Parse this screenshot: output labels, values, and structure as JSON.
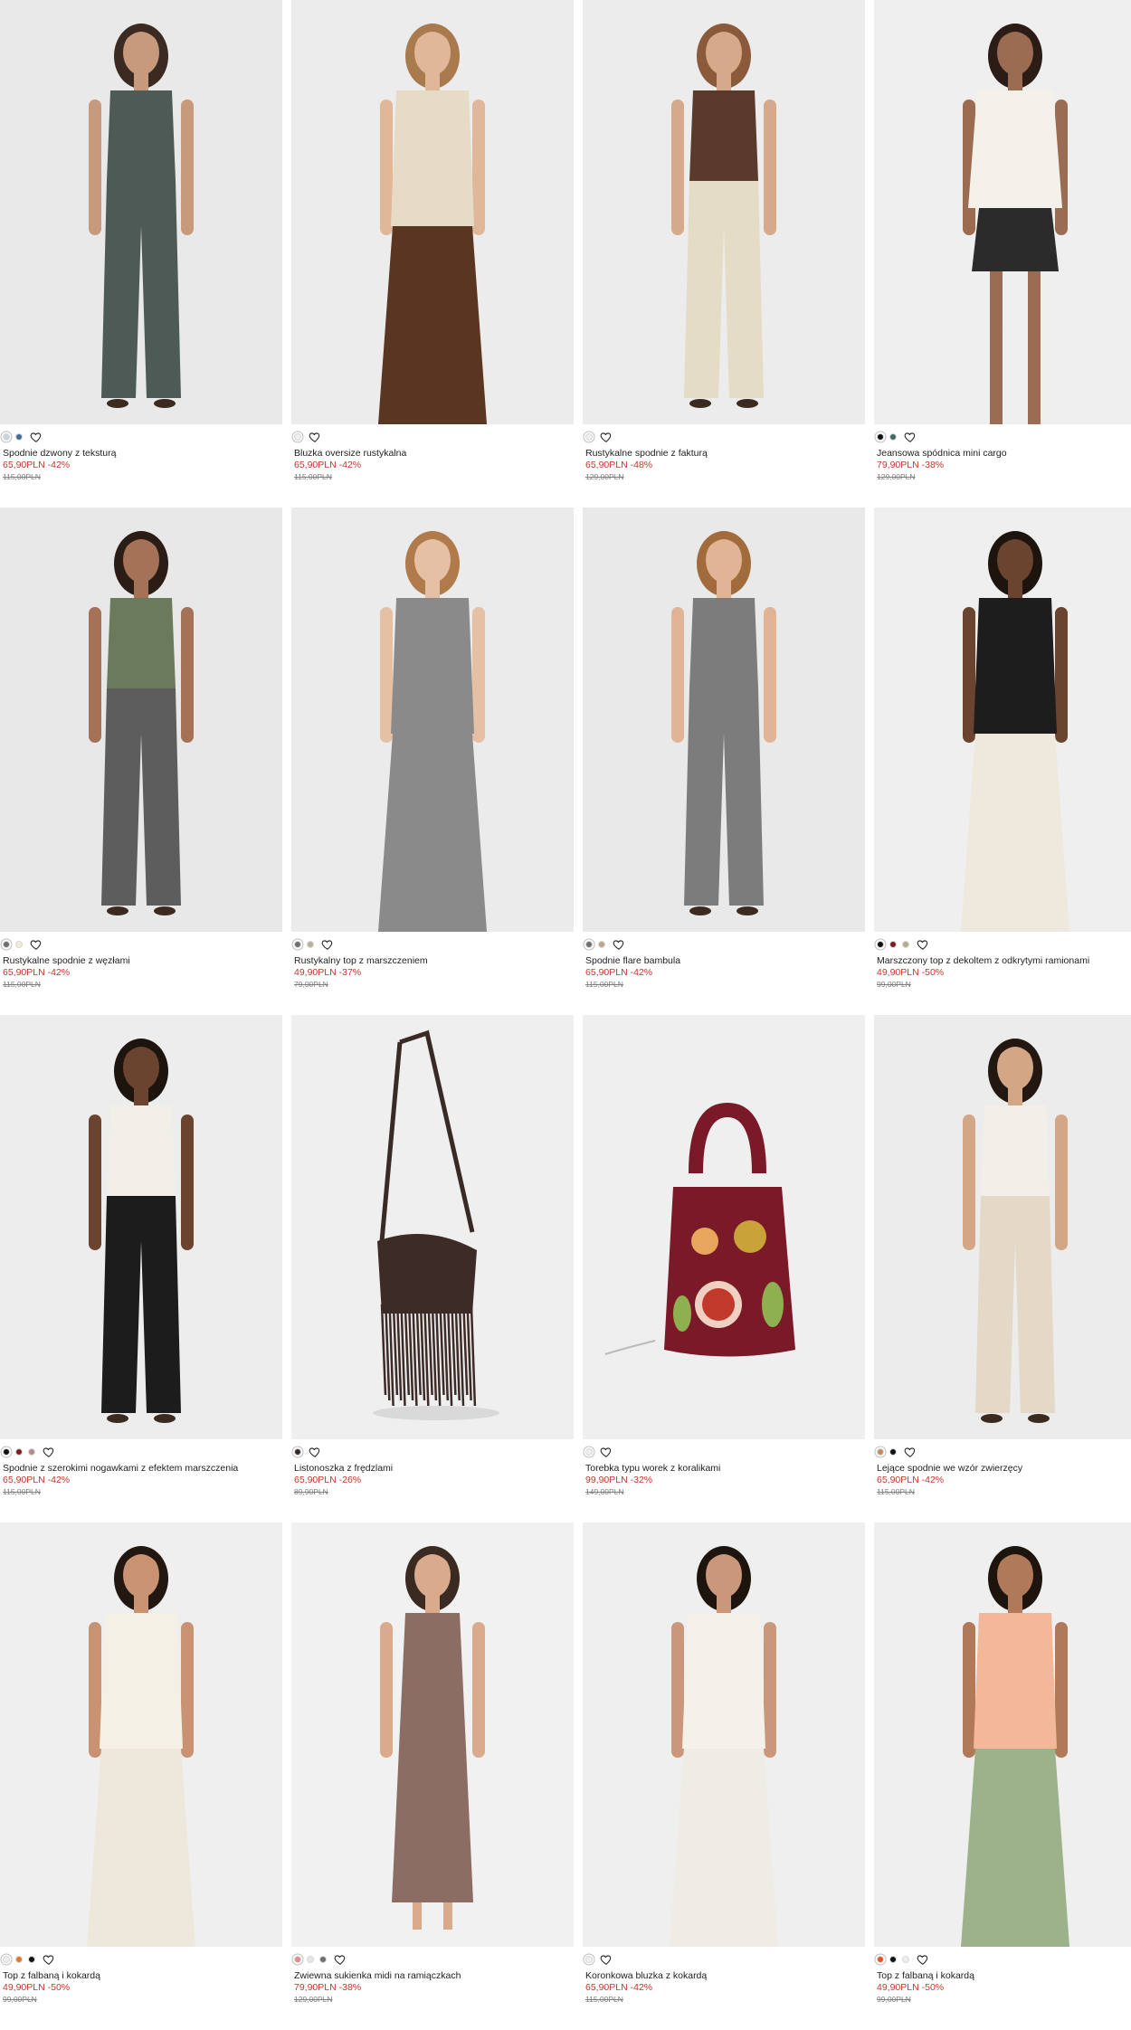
{
  "colors": {
    "sale": "#c0392b",
    "name": "#222222",
    "old_price": "#7d7d7d"
  },
  "products": [
    {
      "name": "Spodnie dzwony z teksturą",
      "price": "65,90PLN",
      "discount": "-42%",
      "old_price": "115,00PLN",
      "swatches": [
        "#c9d4dd",
        "#3d6f98"
      ]
    },
    {
      "name": "Bluzka oversize rustykalna",
      "price": "65,90PLN",
      "discount": "-42%",
      "old_price": "115,00PLN",
      "swatches": [
        "#efefef"
      ]
    },
    {
      "name": "Rustykalne spodnie z fakturą",
      "price": "65,90PLN",
      "discount": "-48%",
      "old_price": "129,00PLN",
      "swatches": [
        "#efefef"
      ]
    },
    {
      "name": "Jeansowa spódnica mini cargo",
      "price": "79,90PLN",
      "discount": "-38%",
      "old_price": "129,00PLN",
      "swatches": [
        "#111111",
        "#3f6b63"
      ]
    },
    {
      "name": "Rustykalne spodnie z węzłami",
      "price": "65,90PLN",
      "discount": "-42%",
      "old_price": "115,00PLN",
      "swatches": [
        "#6e6f73",
        "#f2ead2"
      ]
    },
    {
      "name": "Rustykalny top z marszczeniem",
      "price": "49,90PLN",
      "discount": "-37%",
      "old_price": "79,00PLN",
      "swatches": [
        "#6e6f73",
        "#b8b09a"
      ]
    },
    {
      "name": "Spodnie flare bambula",
      "price": "65,90PLN",
      "discount": "-42%",
      "old_price": "115,00PLN",
      "swatches": [
        "#6e6f73",
        "#b8a982"
      ]
    },
    {
      "name": "Marszczony top z dekoltem z odkrytymi ramionami",
      "price": "49,90PLN",
      "discount": "-50%",
      "old_price": "99,00PLN",
      "swatches": [
        "#111111",
        "#7a1f1f",
        "#b8a98a"
      ]
    },
    {
      "name": "Spodnie z szerokimi nogawkami z efektem marszczenia",
      "price": "65,90PLN",
      "discount": "-42%",
      "old_price": "115,00PLN",
      "swatches": [
        "#111111",
        "#7a1f1f",
        "#b48a86"
      ]
    },
    {
      "name": "Listonoszka z frędzlami",
      "price": "65,90PLN",
      "discount": "-26%",
      "old_price": "89,90PLN",
      "swatches": [
        "#3a2a26"
      ]
    },
    {
      "name": "Torebka typu worek z koralikami",
      "price": "99,90PLN",
      "discount": "-32%",
      "old_price": "149,00PLN",
      "swatches": [
        "#efefef"
      ]
    },
    {
      "name": "Lejące spodnie we wzór zwierzęcy",
      "price": "65,90PLN",
      "discount": "-42%",
      "old_price": "115,00PLN",
      "swatches": [
        "#c98a5a",
        "#111111"
      ]
    },
    {
      "name": "Top z falbaną i kokardą",
      "price": "49,90PLN",
      "discount": "-50%",
      "old_price": "99,00PLN",
      "swatches": [
        "#efefef",
        "#e07a2a",
        "#111111"
      ]
    },
    {
      "name": "Zwiewna sukienka midi na ramiączkach",
      "price": "79,90PLN",
      "discount": "-38%",
      "old_price": "129,00PLN",
      "swatches": [
        "#e38a8a",
        "#e6e6e6",
        "#6e6f73"
      ]
    },
    {
      "name": "Koronkowa bluzka z kokardą",
      "price": "65,90PLN",
      "discount": "-42%",
      "old_price": "115,00PLN",
      "swatches": [
        "#efefef"
      ]
    },
    {
      "name": "Top z falbaną i kokardą",
      "price": "49,90PLN",
      "discount": "-50%",
      "old_price": "99,00PLN",
      "swatches": [
        "#e8561e",
        "#111111",
        "#efefef"
      ]
    }
  ]
}
